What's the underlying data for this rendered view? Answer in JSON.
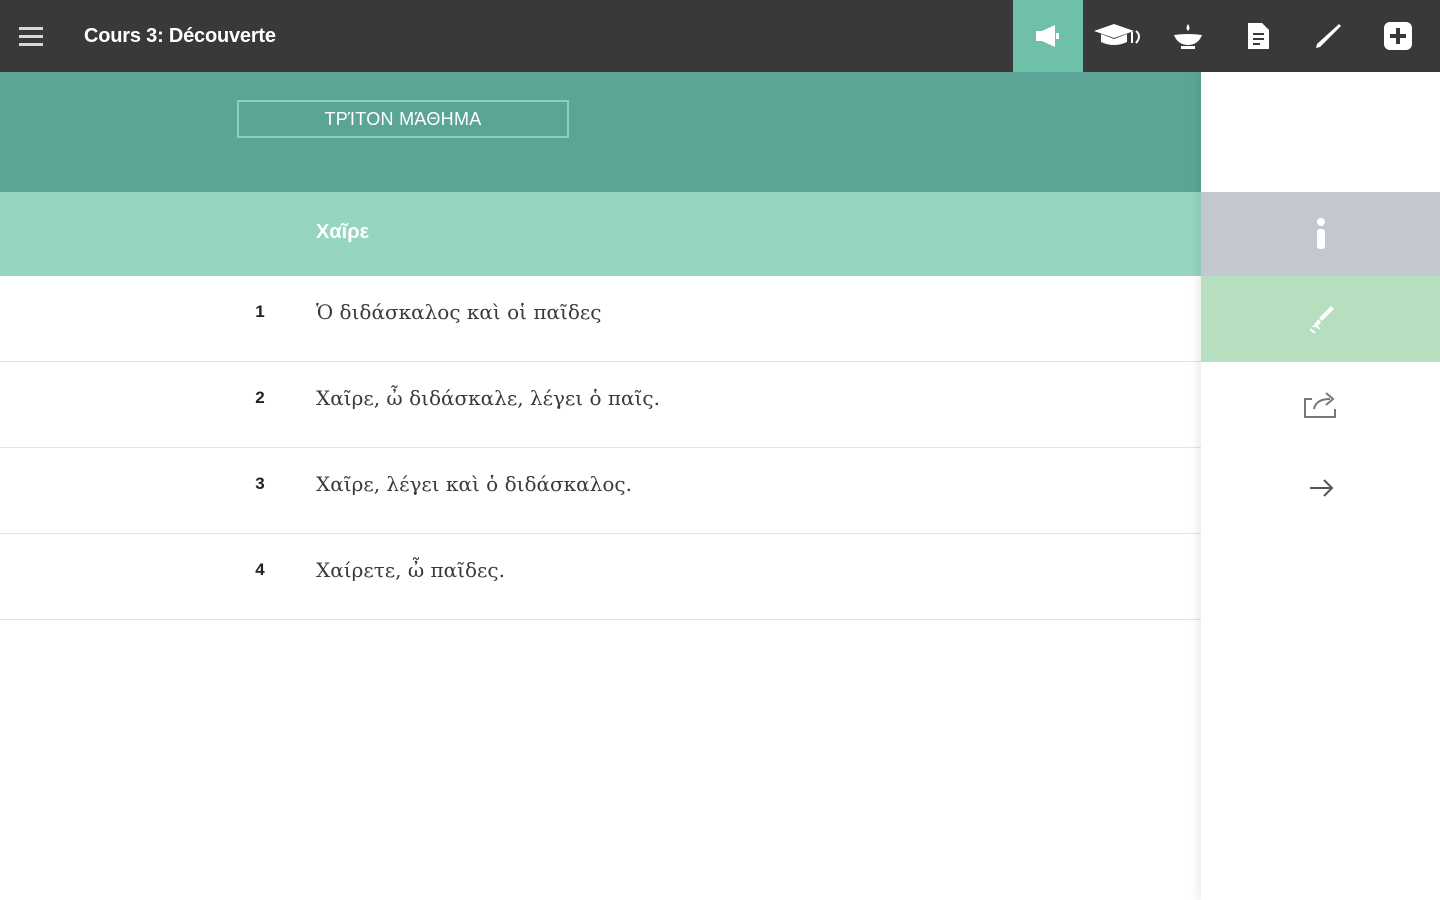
{
  "app": {
    "title": "Cours 3: Découverte",
    "menu_icon": "hamburger-menu-icon"
  },
  "toolbar": {
    "buttons": [
      {
        "icon": "megaphone-icon",
        "active": true
      },
      {
        "icon": "graduation-cap-icon",
        "active": false
      },
      {
        "icon": "lamp-icon",
        "active": false
      },
      {
        "icon": "document-icon",
        "active": false
      },
      {
        "icon": "pen-icon",
        "active": false
      },
      {
        "icon": "add-icon",
        "active": false
      }
    ]
  },
  "lesson": {
    "chip_label": "ΤΡΊΤΟΝ ΜΆΘΗΜΑ",
    "section_title": "Χαῖρε"
  },
  "lines": [
    {
      "number": "1",
      "text": "Ὁ διδάσκαλος καὶ οἱ παῖδες"
    },
    {
      "number": "2",
      "text": "Χαῖρε, ὦ διδάσκαλε, λέγει ὁ παῖς."
    },
    {
      "number": "3",
      "text": "Χαῖρε, λέγει καὶ ὁ διδάσκαλος."
    },
    {
      "number": "4",
      "text": "Χαίρετε, ὦ παῖδες."
    }
  ],
  "side_panel": {
    "buttons": [
      "info-icon",
      "brush-icon",
      "share-icon",
      "arrow-right-icon"
    ]
  },
  "colors": {
    "topbar": "#393939",
    "active_tool": "#6ec1a8",
    "header_band": "#5ba597",
    "title_row": "#96d5c1",
    "info_bg": "#c3c7d0",
    "brush_bg": "#b6dfbf"
  }
}
